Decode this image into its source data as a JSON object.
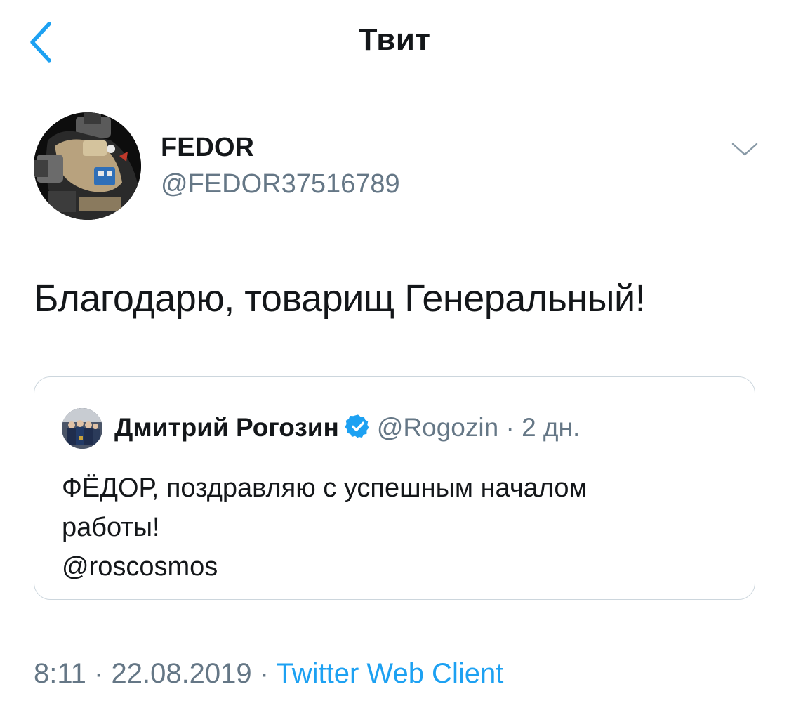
{
  "header": {
    "title": "Твит",
    "back_icon": "chevron-left-icon"
  },
  "author": {
    "display_name": "FEDOR",
    "handle": "@FEDOR37516789",
    "menu_icon": "chevron-down-icon"
  },
  "tweet": {
    "text": "Благодарю, товарищ Генеральный!"
  },
  "quoted_tweet": {
    "display_name": "Дмитрий Рогозин",
    "verified_icon": "verified-badge-icon",
    "handle": "@Rogozin",
    "separator": "·",
    "age": "2 дн.",
    "lines": [
      "ФЁДОР, поздравляю с успешным началом",
      "работы!",
      "@roscosmos"
    ]
  },
  "footer": {
    "time": "8:11",
    "sep1": "·",
    "date": "22.08.2019",
    "sep2": "·",
    "client": "Twitter Web Client"
  },
  "colors": {
    "accent": "#1da1f2",
    "secondary_text": "#657786",
    "primary_text": "#14171a",
    "border": "#ccd6dd"
  }
}
